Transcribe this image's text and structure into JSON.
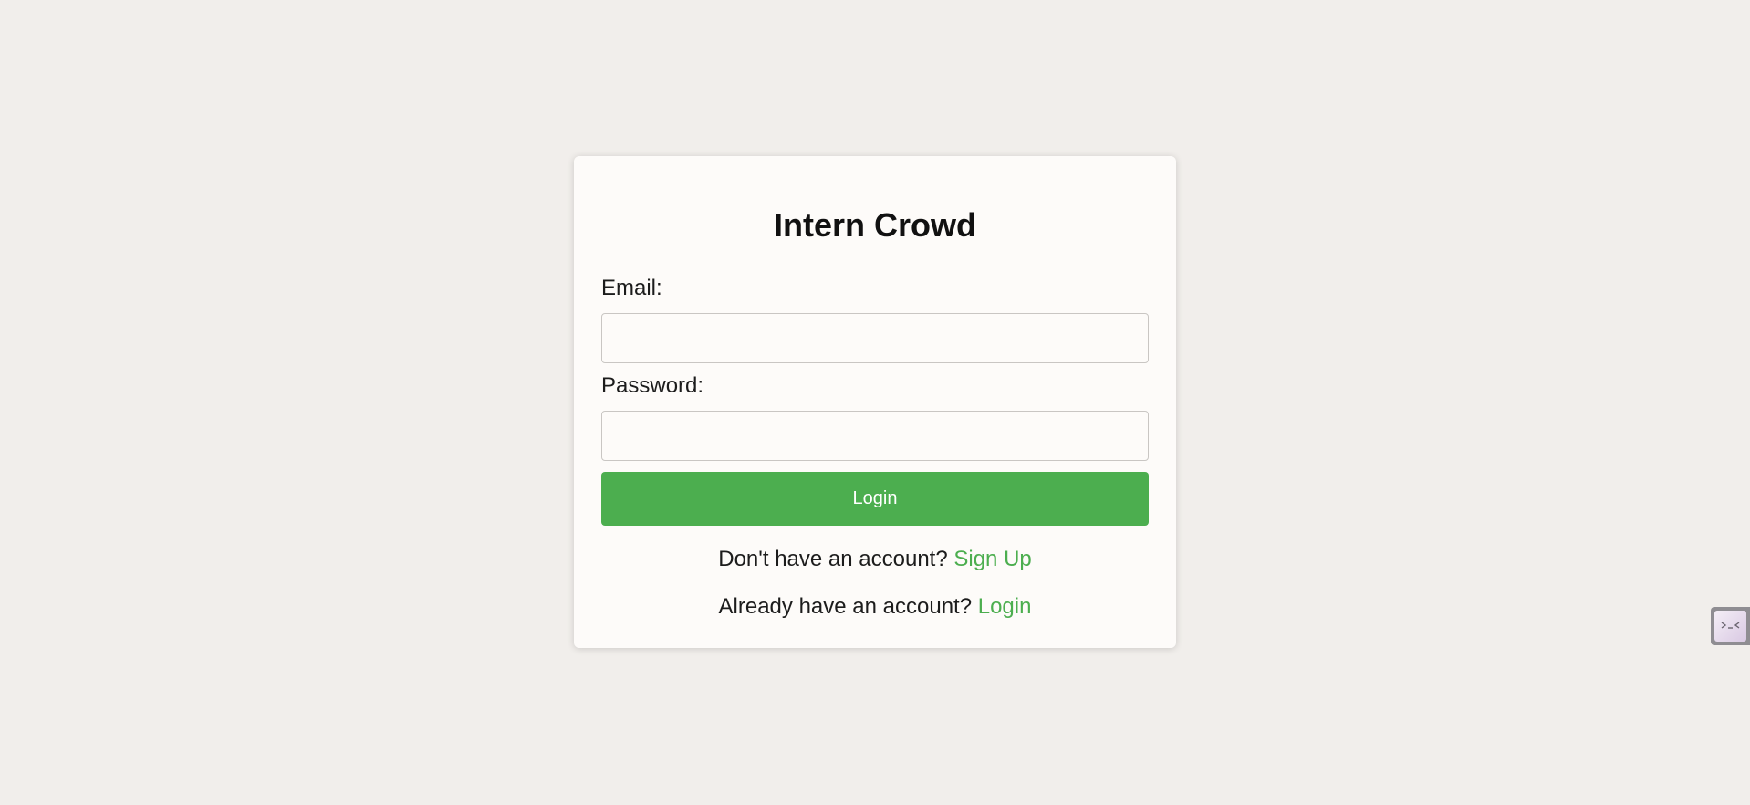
{
  "app": {
    "title": "Intern Crowd"
  },
  "form": {
    "email_label": "Email:",
    "email_value": "",
    "email_placeholder": "",
    "password_label": "Password:",
    "password_value": "",
    "password_placeholder": "",
    "login_button_label": "Login"
  },
  "footer": {
    "signup_prompt": "Don't have an account?",
    "signup_link": "Sign Up",
    "login_prompt": "Already have an account?",
    "login_link": "Login"
  },
  "side_widget": {
    "icon": "terminal-face-icon"
  },
  "colors": {
    "accent": "#4cae4f",
    "page_background": "#f1eeeb",
    "card_background": "#fdfbf9"
  }
}
